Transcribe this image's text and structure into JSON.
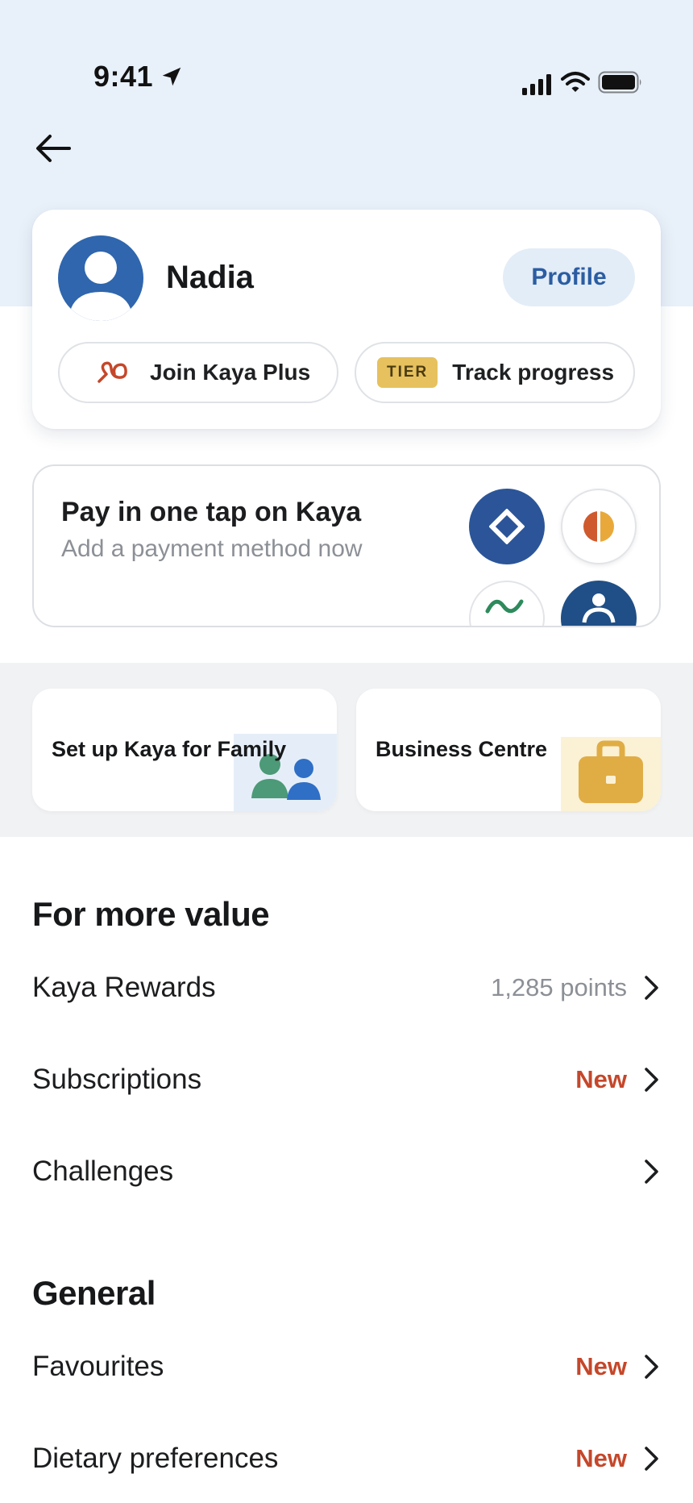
{
  "status_bar": {
    "time": "9:41",
    "icons": [
      "location-arrow-icon",
      "signal-icon",
      "wifi-icon",
      "battery-icon"
    ]
  },
  "nav": {
    "back_icon": "arrow-left-icon"
  },
  "profile": {
    "name": "Nadia",
    "profile_button": "Profile",
    "join_plus_label": "Join Kaya Plus",
    "tier_badge": "TIER",
    "track_label": "Track progress"
  },
  "payment": {
    "title": "Pay in one tap on Kaya",
    "subtitle": "Add a payment method now"
  },
  "shortcuts": [
    {
      "label": "Set up Kaya for Family",
      "icon": "family-icon"
    },
    {
      "label": "Business Centre",
      "icon": "briefcase-icon"
    }
  ],
  "more_value": {
    "title": "For more value",
    "items": [
      {
        "label": "Kaya Rewards",
        "meta": "1,285 points",
        "meta_type": "gray"
      },
      {
        "label": "Subscriptions",
        "meta": "New",
        "meta_type": "new"
      },
      {
        "label": "Challenges",
        "meta": "",
        "meta_type": "none"
      }
    ]
  },
  "general": {
    "title": "General",
    "items": [
      {
        "label": "Favourites",
        "meta": "New",
        "meta_type": "new"
      },
      {
        "label": "Dietary preferences",
        "meta": "New",
        "meta_type": "new"
      }
    ]
  },
  "colors": {
    "top_band": "#e8f0f9",
    "brand_blue": "#2f66ad",
    "new_badge": "#c5472a",
    "tier_gold": "#e6c15e"
  }
}
